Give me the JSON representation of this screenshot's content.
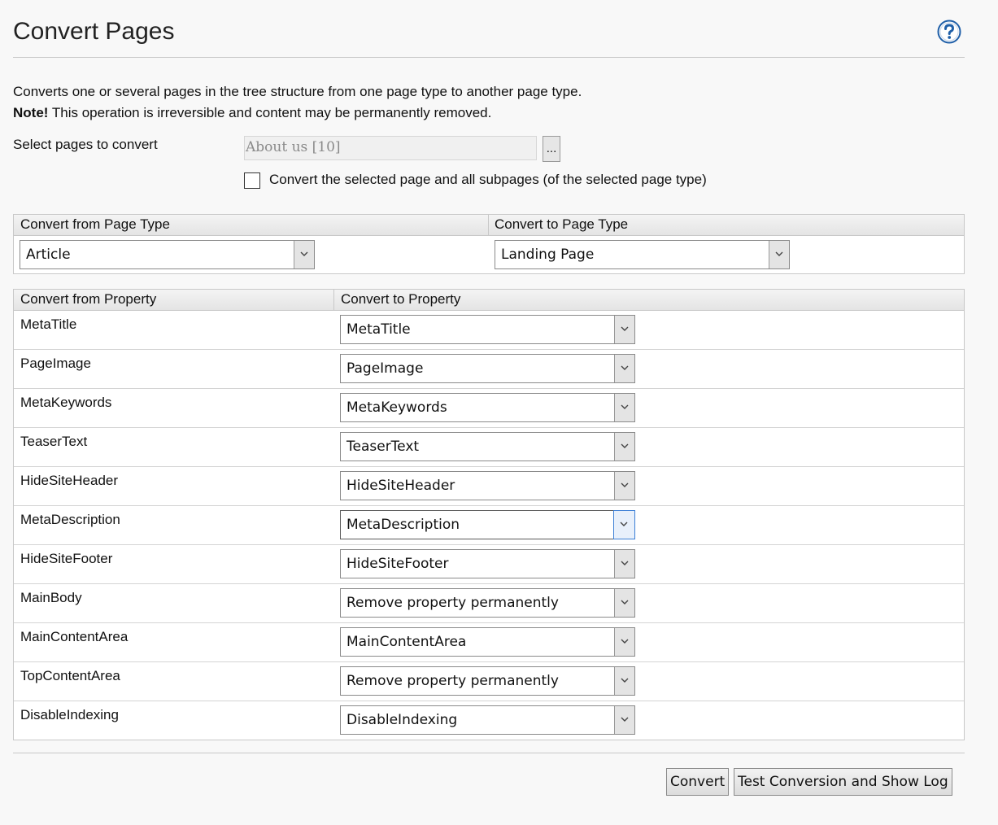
{
  "header": {
    "title": "Convert Pages",
    "help_icon": "question-circle-icon"
  },
  "description": {
    "line1": "Converts one or several pages in the tree structure from one page type to another page type.",
    "note_label": "Note!",
    "note_text": " This operation is irreversible and content may be permanently removed."
  },
  "selection": {
    "label": "Select pages to convert",
    "page_value": "About us [10]",
    "browse_label": "...",
    "subpages_checked": false,
    "subpages_label": "Convert the selected page and all subpages (of the selected page type)"
  },
  "page_types": {
    "from_header": "Convert from Page Type",
    "to_header": "Convert to Page Type",
    "from_value": "Article",
    "to_value": "Landing Page"
  },
  "properties": {
    "from_header": "Convert from Property",
    "to_header": "Convert to Property",
    "rows": [
      {
        "from": "MetaTitle",
        "to": "MetaTitle"
      },
      {
        "from": "PageImage",
        "to": "PageImage"
      },
      {
        "from": "MetaKeywords",
        "to": "MetaKeywords"
      },
      {
        "from": "TeaserText",
        "to": "TeaserText"
      },
      {
        "from": "HideSiteHeader",
        "to": "HideSiteHeader"
      },
      {
        "from": "MetaDescription",
        "to": "MetaDescription"
      },
      {
        "from": "HideSiteFooter",
        "to": "HideSiteFooter"
      },
      {
        "from": "MainBody",
        "to": "Remove property permanently"
      },
      {
        "from": "MainContentArea",
        "to": "MainContentArea"
      },
      {
        "from": "TopContentArea",
        "to": "Remove property permanently"
      },
      {
        "from": "DisableIndexing",
        "to": "DisableIndexing"
      }
    ]
  },
  "actions": {
    "convert_label": "Convert",
    "test_label": "Test Conversion and Show Log"
  },
  "colors": {
    "help_icon": "#1f5fa8",
    "focus_border": "#3c7fd6"
  }
}
